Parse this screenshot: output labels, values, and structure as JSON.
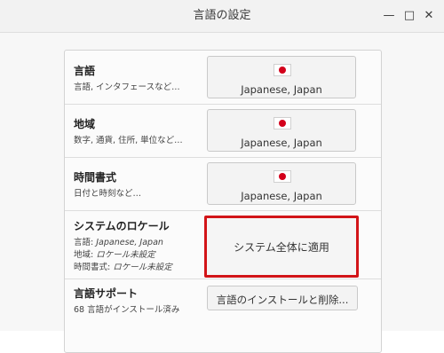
{
  "window": {
    "title": "言語の設定"
  },
  "controls": {
    "minimize": "—",
    "maximize": "□",
    "close": "✕"
  },
  "rows": [
    {
      "title": "言語",
      "subtitle": "言語, インタフェースなど…",
      "button": "Japanese, Japan",
      "flag_icon": "japan-flag-icon"
    },
    {
      "title": "地域",
      "subtitle": "数字, 通貨, 住所, 単位など…",
      "button": "Japanese, Japan",
      "flag_icon": "japan-flag-icon"
    },
    {
      "title": "時間書式",
      "subtitle": "日付と時刻など…",
      "button": "Japanese, Japan",
      "flag_icon": "japan-flag-icon"
    }
  ],
  "system_locale": {
    "title": "システムのロケール",
    "language_label": "言語: ",
    "language_value": "Japanese, Japan",
    "region_label": "地域: ",
    "region_value": "ロケール未設定",
    "time_label": "時間書式: ",
    "time_value": "ロケール未設定",
    "button": "システム全体に適用"
  },
  "language_support": {
    "title": "言語サポート",
    "subtitle": "68 言語がインストール済み",
    "button": "言語のインストールと削除..."
  },
  "colors": {
    "highlight_border": "#d21418",
    "flag_red": "#d3001b"
  }
}
